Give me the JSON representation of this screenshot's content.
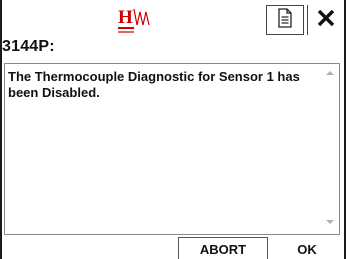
{
  "header": {
    "logo_icon": "hw-logo-icon",
    "document_icon": "document-icon",
    "close_icon": "close-icon",
    "title": "3144P:"
  },
  "message": {
    "text": "The Thermocouple Diagnostic for Sensor 1 has been Disabled."
  },
  "buttons": {
    "abort_label": "ABORT",
    "ok_label": "OK"
  },
  "colors": {
    "logo_red": "#cc0000"
  }
}
